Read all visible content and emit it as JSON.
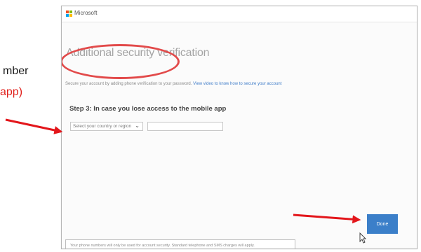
{
  "side_text": {
    "line1": "mber",
    "line2": "app)"
  },
  "window": {
    "brand": "Microsoft",
    "title": "Additional security verification",
    "description": "Secure your account by adding phone verification to your password.",
    "description_link": "View video to know how to secure your account",
    "step_heading": "Step 3: In case you lose access to the mobile app",
    "country_select": {
      "value": "Select your country or region"
    },
    "phone_field": {
      "value": ""
    },
    "done_label": "Done",
    "footer_note": "Your phone numbers will only be used for account security. Standard telephone and SMS charges will apply."
  },
  "icons": {
    "logo": "microsoft-logo-icon",
    "chevron": "chevron-down-icon",
    "cursor": "mouse-cursor-icon"
  },
  "colors": {
    "annotation_red": "#e3161b",
    "button_blue": "#3b7fc9",
    "logo": [
      "#f25022",
      "#7fba00",
      "#00a4ef",
      "#ffb900"
    ]
  }
}
